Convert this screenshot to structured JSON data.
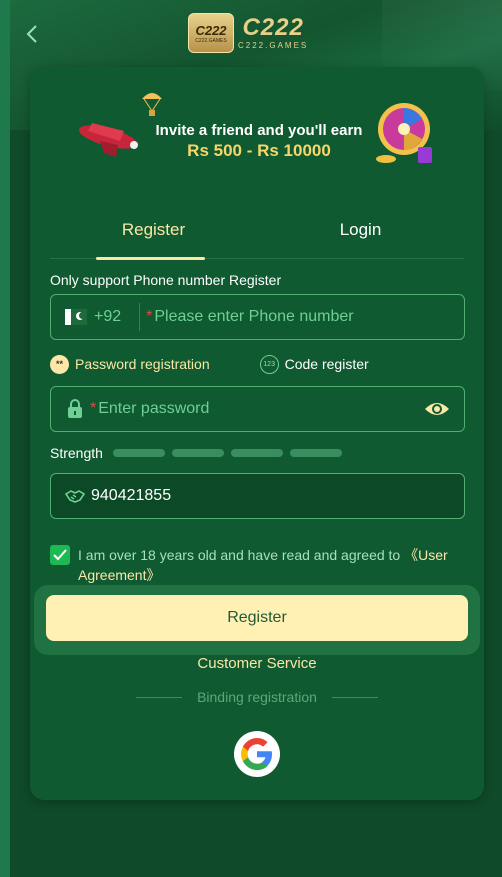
{
  "header": {
    "logo_badge_text": "C222",
    "logo_badge_sub": "C222.GAMES",
    "logo_word": "C222",
    "logo_word_sub": "C222.GAMES"
  },
  "banner": {
    "line1": "Invite a friend and you'll earn",
    "line2": "Rs 500 - Rs 10000"
  },
  "tabs": [
    {
      "label": "Register",
      "active": true
    },
    {
      "label": "Login",
      "active": false
    }
  ],
  "form": {
    "phone_section_label": "Only support Phone number Register",
    "country_code": "+92",
    "phone_required_mark": "*",
    "phone_placeholder": "Please enter Phone number",
    "reg_type_password": "Password registration",
    "reg_type_password_icon_text": "**",
    "reg_type_code": "Code register",
    "reg_type_code_icon_text": "123",
    "password_required_mark": "*",
    "password_placeholder": "Enter password",
    "strength_label": "Strength",
    "invite_code_value": "940421855",
    "agreement_text": "I am over 18 years old and have read and agreed to ",
    "agreement_link": "《User Agreement》",
    "agreement_checked": true,
    "register_button": "Register"
  },
  "footer": {
    "customer_service": "Customer Service",
    "binding_label": "Binding registration"
  },
  "colors": {
    "accent": "#fbe7a7",
    "background": "#0f4a2a",
    "card": "#0f5a30",
    "input_border": "#4fae74",
    "check": "#1db954"
  },
  "icons": [
    "back-arrow-icon",
    "pakistan-flag-icon",
    "lock-icon",
    "eye-icon",
    "handshake-icon",
    "check-icon",
    "google-icon"
  ]
}
